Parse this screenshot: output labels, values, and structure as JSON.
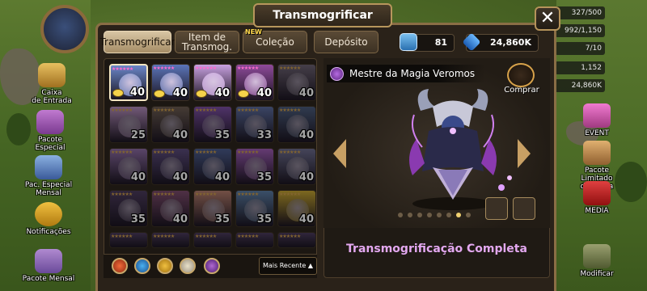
{
  "window": {
    "title": "Transmogrificar",
    "close_label": "✕"
  },
  "tabs": [
    {
      "label": "Transmogrificar",
      "active": true
    },
    {
      "label": "Item de",
      "label2": "Transmog.",
      "active": false
    },
    {
      "label": "Coleção",
      "active": false,
      "badge": "NEW"
    },
    {
      "label": "Depósito",
      "active": false
    }
  ],
  "currency": {
    "tokens": "81",
    "crystals": "24,860K"
  },
  "resources": [
    "327/500",
    "992/1,150",
    "7/10",
    "1,152",
    "24,860K"
  ],
  "left_menu": [
    {
      "label": "Caixa",
      "label2": "de Entrada"
    },
    {
      "label": "Pacote",
      "label2": "Especial"
    },
    {
      "label": "Pac. Especial",
      "label2": "Mensal"
    },
    {
      "label": "Notificações",
      "label2": ""
    },
    {
      "label": "Pacote Mensal",
      "label2": ""
    }
  ],
  "right_menu": [
    {
      "label": "EVENT",
      "label2": ""
    },
    {
      "label": "Pacote Limitado",
      "label2": "de Conta"
    },
    {
      "label": "MEDIA",
      "label2": ""
    },
    {
      "label": "Modificar",
      "label2": ""
    }
  ],
  "grid": {
    "rows": [
      [
        {
          "lvl": "40",
          "eye": true,
          "sel": true,
          "c": "#6a86c8"
        },
        {
          "lvl": "40",
          "eye": true,
          "c": "#5b74b8"
        },
        {
          "lvl": "40",
          "eye": true,
          "c": "#c8a0e0"
        },
        {
          "lvl": "40",
          "eye": true,
          "c": "#8e4a9a"
        },
        {
          "lvl": "40",
          "eye": false,
          "dim": true,
          "c": "#6a6070"
        }
      ],
      [
        {
          "lvl": "25",
          "c": "#b08ab8",
          "dim": true
        },
        {
          "lvl": "40",
          "c": "#6a5a50",
          "dim": true
        },
        {
          "lvl": "35",
          "c": "#7a4ea0",
          "dim": true
        },
        {
          "lvl": "33",
          "c": "#5a6a9a",
          "dim": true
        },
        {
          "lvl": "40",
          "c": "#4a5a7a",
          "dim": true
        }
      ],
      [
        {
          "lvl": "40",
          "c": "#8a6aa0",
          "dim": true
        },
        {
          "lvl": "40",
          "c": "#5a4a7a",
          "dim": true
        },
        {
          "lvl": "40",
          "c": "#4a5a8a",
          "dim": true
        },
        {
          "lvl": "35",
          "c": "#9a5ab0",
          "dim": true
        },
        {
          "lvl": "40",
          "c": "#6a6a8a",
          "dim": true
        }
      ],
      [
        {
          "lvl": "35",
          "c": "#4a3a5a",
          "dim": true
        },
        {
          "lvl": "40",
          "c": "#7a4a6a",
          "dim": true
        },
        {
          "lvl": "35",
          "c": "#b07a6a",
          "dim": true
        },
        {
          "lvl": "35",
          "c": "#5a7aa0",
          "dim": true
        },
        {
          "lvl": "40",
          "c": "#c0a030",
          "dim": true
        }
      ]
    ]
  },
  "filters": {
    "sort_label": "Mais Recente"
  },
  "preview": {
    "name": "Mestre da Magia Veromos",
    "buy_label": "Comprar",
    "status": "Transmogrificação Completa",
    "pages": 8,
    "current_page": 7
  },
  "colors": {
    "accent": "#c8a064",
    "status": "#e3a8f0",
    "panel": "#2a2219"
  }
}
